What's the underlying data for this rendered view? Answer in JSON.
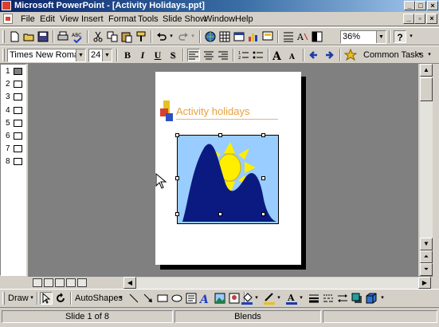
{
  "window": {
    "title": "Microsoft PowerPoint - [Activity Holidays.ppt]",
    "controls": {
      "minimize": "_",
      "maximize": "□",
      "close": "×"
    }
  },
  "menu": {
    "items": [
      "File",
      "Edit",
      "View",
      "Insert",
      "Format",
      "Tools",
      "Slide Show",
      "Window",
      "Help"
    ],
    "doc_controls": {
      "minimize": "_",
      "restore": "▫",
      "close": "×"
    }
  },
  "standard_toolbar": {
    "zoom": "36%",
    "help_glyph": "?"
  },
  "formatting_toolbar": {
    "font": "Times New Roman",
    "size": "24",
    "bold": "B",
    "italic": "I",
    "underline": "U",
    "shadow": "S",
    "common_tasks": "Common Tasks"
  },
  "outline": {
    "slides": [
      "1",
      "2",
      "3",
      "4",
      "5",
      "6",
      "7",
      "8"
    ]
  },
  "slide": {
    "title": "Activity holidays",
    "logo_colors": [
      "#e8c020",
      "#d8412f",
      "#3050c0"
    ],
    "picture": {
      "sky_color": "#99ccff",
      "mountain_color": "#0b1a80",
      "sun_color": "#ffee00"
    }
  },
  "draw_toolbar": {
    "draw_label": "Draw",
    "autoshapes_label": "AutoShapes"
  },
  "status": {
    "slide_position": "Slide 1 of 8",
    "design_template": "Blends"
  }
}
